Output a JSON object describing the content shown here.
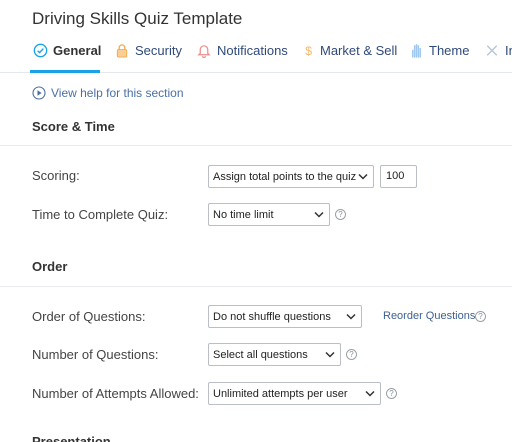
{
  "page": {
    "title": "Driving Skills Quiz Template"
  },
  "tabs": [
    {
      "label": "General",
      "icon": "check-circle-icon",
      "active": true
    },
    {
      "label": "Security",
      "icon": "lock-icon"
    },
    {
      "label": "Notifications",
      "icon": "bell-icon"
    },
    {
      "label": "Market & Sell",
      "icon": "dollar-icon"
    },
    {
      "label": "Theme",
      "icon": "hand-icon"
    },
    {
      "label": "In",
      "icon": "tools-icon"
    }
  ],
  "help": {
    "label": "View help for this section"
  },
  "sections": {
    "score_time": {
      "title": "Score & Time",
      "scoring": {
        "label": "Scoring:",
        "value": "Assign total points to the quiz",
        "points": "100"
      },
      "time": {
        "label": "Time to Complete Quiz:",
        "value": "No time limit"
      }
    },
    "order": {
      "title": "Order",
      "order_questions": {
        "label": "Order of Questions:",
        "value": "Do not shuffle questions",
        "link": "Reorder Questions"
      },
      "num_questions": {
        "label": "Number of Questions:",
        "value": "Select all questions"
      },
      "attempts": {
        "label": "Number of Attempts Allowed:",
        "value": "Unlimited attempts per user"
      }
    },
    "presentation": {
      "title": "Presentation"
    }
  },
  "colors": {
    "accent": "#1aa3e8",
    "tab_text": "#2f4a7a",
    "link": "#3d5f93",
    "icon_orange": "#f5a94a",
    "icon_pink": "#f08a8a",
    "icon_blue": "#9ec7ef"
  }
}
